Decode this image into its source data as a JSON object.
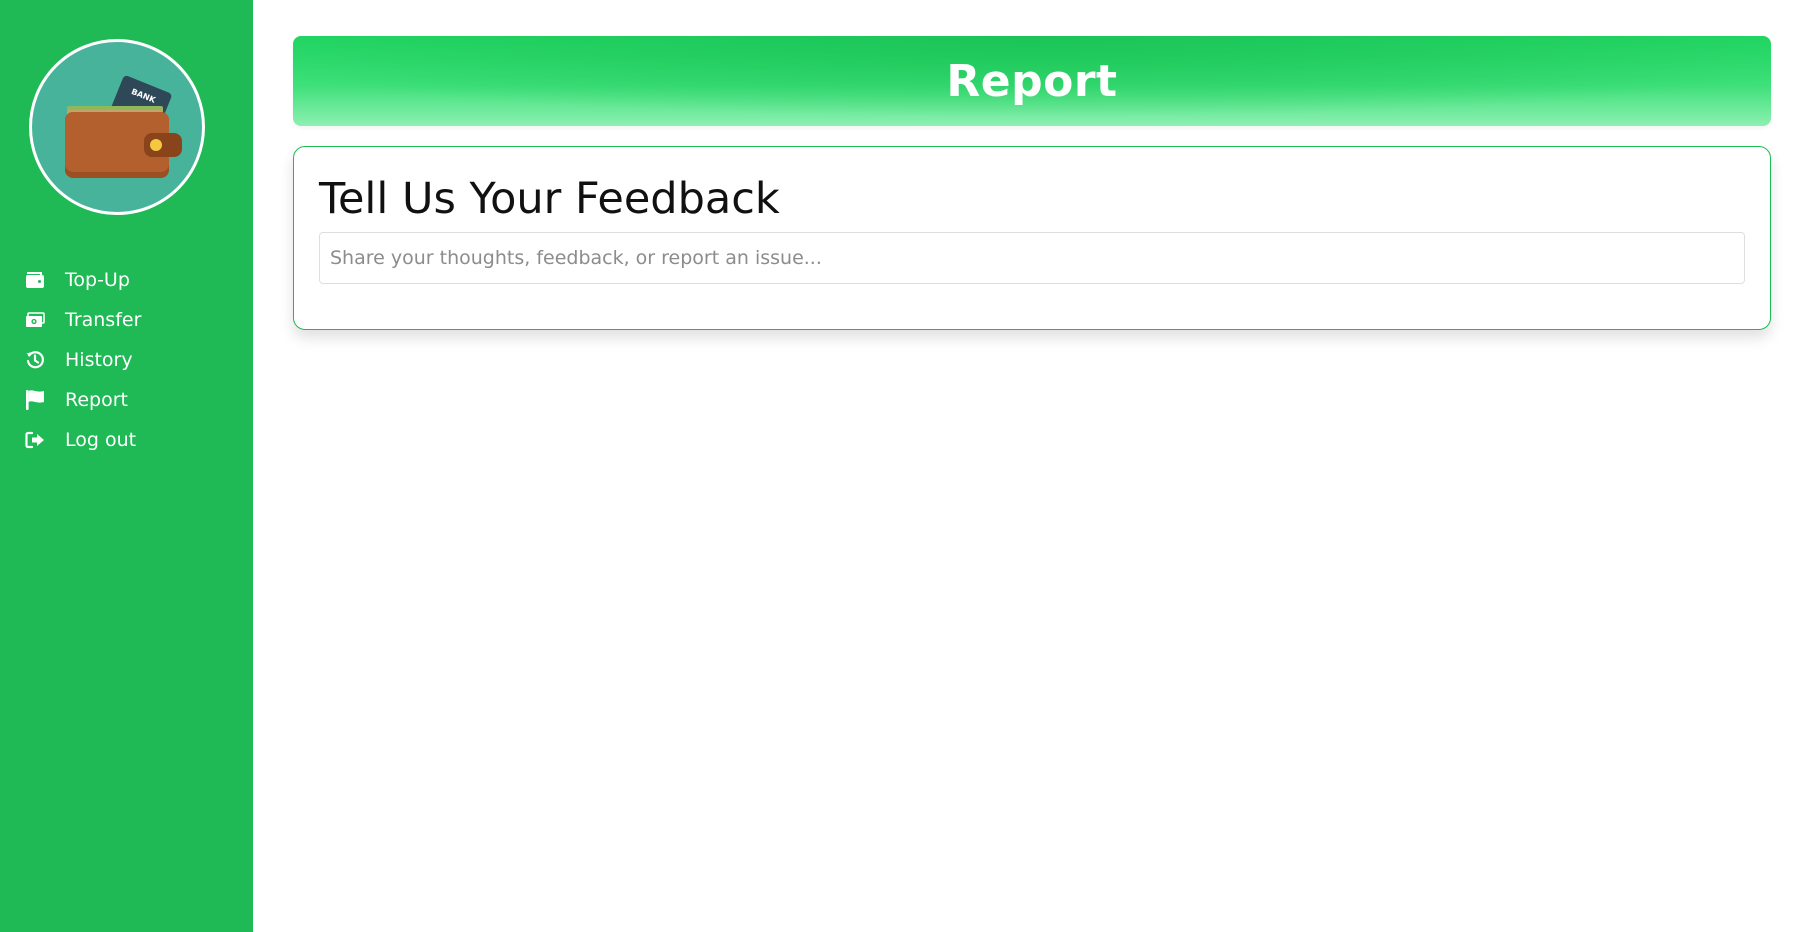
{
  "sidebar": {
    "logo": {
      "icon": "wallet-icon",
      "card_text": "BANK",
      "bg_color": "#48b39b"
    },
    "items": [
      {
        "label": "Top-Up",
        "icon": "wallet-icon"
      },
      {
        "label": "Transfer",
        "icon": "money-bill-icon"
      },
      {
        "label": "History",
        "icon": "history-icon"
      },
      {
        "label": "Report",
        "icon": "flag-icon"
      },
      {
        "label": "Log out",
        "icon": "logout-icon"
      }
    ],
    "bg_color": "#1fb955"
  },
  "header": {
    "title": "Report"
  },
  "feedback": {
    "title": "Tell Us Your Feedback",
    "input_placeholder": "Share your thoughts, feedback, or report an issue...",
    "input_value": ""
  },
  "colors": {
    "accent": "#1fb955",
    "banner": "#22d864"
  }
}
